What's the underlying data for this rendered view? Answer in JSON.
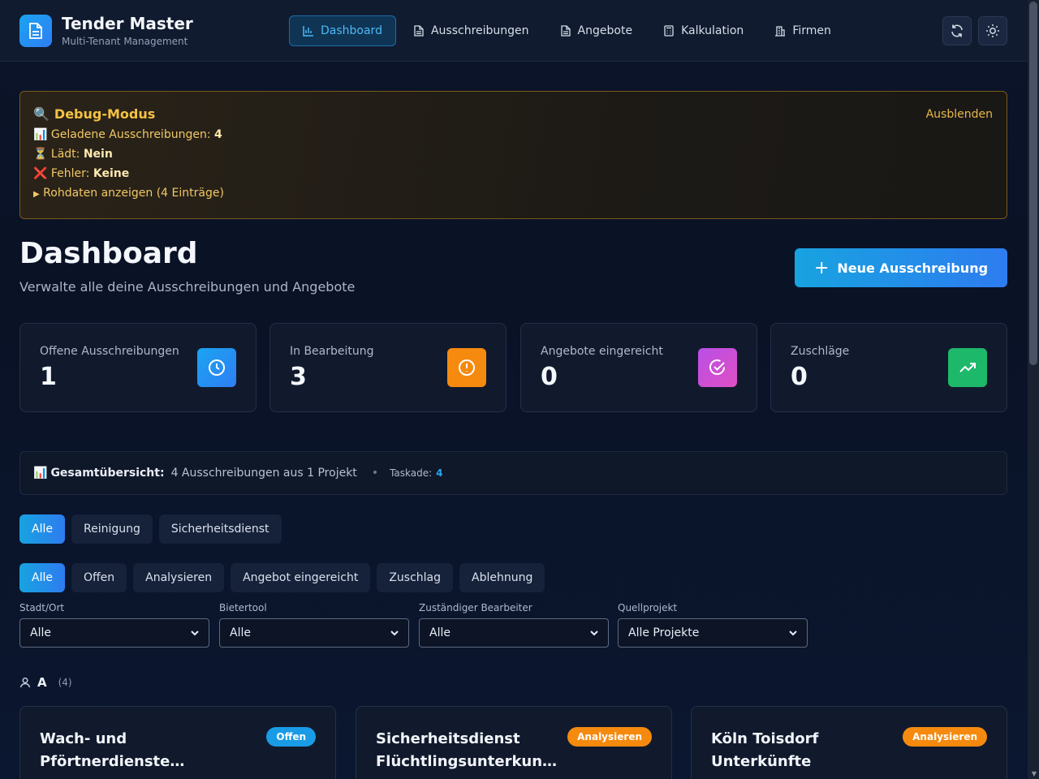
{
  "header": {
    "title": "Tender Master",
    "subtitle": "Multi-Tenant Management",
    "nav": [
      {
        "label": "Dashboard",
        "icon": "bar-chart-icon"
      },
      {
        "label": "Ausschreibungen",
        "icon": "document-icon"
      },
      {
        "label": "Angebote",
        "icon": "document-icon"
      },
      {
        "label": "Kalkulation",
        "icon": "calculator-icon"
      },
      {
        "label": "Firmen",
        "icon": "building-icon"
      }
    ]
  },
  "debug": {
    "title": "Debug-Modus",
    "hide_label": "Ausblenden",
    "loaded_label": "Geladene Ausschreibungen:",
    "loaded_value": "4",
    "loading_label": "Lädt:",
    "loading_value": "Nein",
    "error_label": "Fehler:",
    "error_value": "Keine",
    "raw_label": "Rohdaten anzeigen (4 Einträge)"
  },
  "page": {
    "title": "Dashboard",
    "subtitle": "Verwalte alle deine Ausschreibungen und Angebote",
    "new_button": "Neue Ausschreibung"
  },
  "stats": [
    {
      "label": "Offene Ausschreibungen",
      "value": "1",
      "color": "#1a9be6"
    },
    {
      "label": "In Bearbeitung",
      "value": "3",
      "color": "#f58a0f"
    },
    {
      "label": "Angebote eingereicht",
      "value": "0",
      "color": "#c44fe0"
    },
    {
      "label": "Zuschläge",
      "value": "0",
      "color": "#1db86a"
    }
  ],
  "overview": {
    "label": "Gesamtübersicht:",
    "text": "4 Ausschreibungen aus 1 Projekt",
    "task_label": "Taskade:",
    "task_value": "4"
  },
  "category_filters": [
    "Alle",
    "Reinigung",
    "Sicherheitsdienst"
  ],
  "status_filters": [
    "Alle",
    "Offen",
    "Analysieren",
    "Angebot eingereicht",
    "Zuschlag",
    "Ablehnung"
  ],
  "selects": [
    {
      "label": "Stadt/Ort",
      "value": "Alle"
    },
    {
      "label": "Bietertool",
      "value": "Alle"
    },
    {
      "label": "Zuständiger Bearbeiter",
      "value": "Alle"
    },
    {
      "label": "Quellprojekt",
      "value": "Alle Projekte"
    }
  ],
  "group": {
    "letter": "A",
    "count": "(4)"
  },
  "cards": [
    {
      "title_line1": "Wach- und",
      "title_line2": "Pförtnerdienste…",
      "badge": "Offen",
      "badge_color": "#1a9be6"
    },
    {
      "title_line1": "Sicherheitsdienst",
      "title_line2": "Flüchtlingsunterkun…",
      "badge": "Analysieren",
      "badge_color": "#f58a0f"
    },
    {
      "title_line1": "Köln Toisdorf",
      "title_line2": "Unterkünfte",
      "badge": "Analysieren",
      "badge_color": "#f58a0f"
    }
  ]
}
